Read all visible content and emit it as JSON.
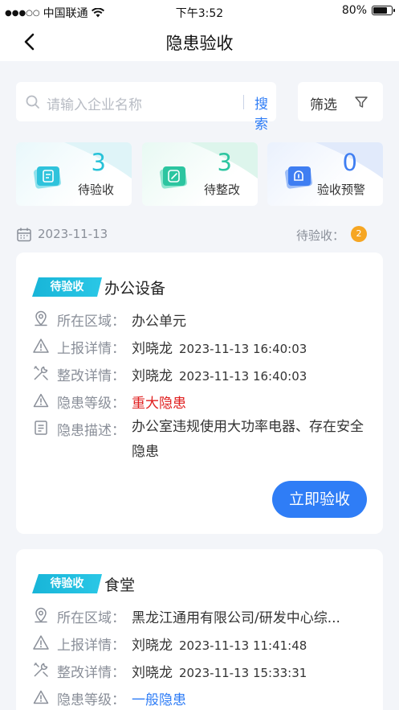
{
  "status_bar": {
    "signal": "●●●○○",
    "carrier": "中国联通",
    "time": "下午3:52",
    "battery_text": "80%",
    "battery_level": 0.8
  },
  "nav": {
    "title": "隐患验收",
    "back_icon": "chevron-left-icon"
  },
  "search": {
    "placeholder": "请输入企业名称",
    "button_label": "搜索",
    "icon": "search-icon"
  },
  "filter": {
    "label": "筛选",
    "icon": "funnel-icon"
  },
  "stats": [
    {
      "value": "3",
      "label": "待验收",
      "color": "#27c2d8",
      "icon": "document-icon"
    },
    {
      "value": "3",
      "label": "待整改",
      "color": "#2cc5a0",
      "icon": "edit-icon"
    },
    {
      "value": "0",
      "label": "验收预警",
      "color": "#3f7ef2",
      "icon": "alert-folder-icon"
    }
  ],
  "date_bar": {
    "date": "2023-11-13",
    "pending_label": "待验收：",
    "pending_count": "2",
    "icon": "calendar-icon"
  },
  "labels": {
    "area": "所在区域：",
    "report": "上报详情：",
    "rectify": "整改详情：",
    "level": "隐患等级：",
    "desc": "隐患描述："
  },
  "cards": [
    {
      "tag": "待验收",
      "title": "办公设备",
      "area": "办公单元",
      "report_user": "刘晓龙",
      "report_time": "2023-11-13 16:40:03",
      "rectify_user": "刘晓龙",
      "rectify_time": "2023-11-13 16:40:03",
      "level": "重大隐患",
      "level_color": "#e02020",
      "desc": "办公室违规使用大功率电器、存在安全隐患",
      "button": "立即验收"
    },
    {
      "tag": "待验收",
      "title": "食堂",
      "area": "黑龙江通用有限公司/研发中心综...",
      "report_user": "刘晓龙",
      "report_time": "2023-11-13 11:41:48",
      "rectify_user": "刘晓龙",
      "rectify_time": "2023-11-13 15:33:31",
      "level": "一般隐患",
      "level_color": "#2f7df6"
    }
  ],
  "colors": {
    "accent": "#2f7df6",
    "tag": "#18b5d8",
    "badge": "#f6a623",
    "background": "#f3f5f9"
  }
}
